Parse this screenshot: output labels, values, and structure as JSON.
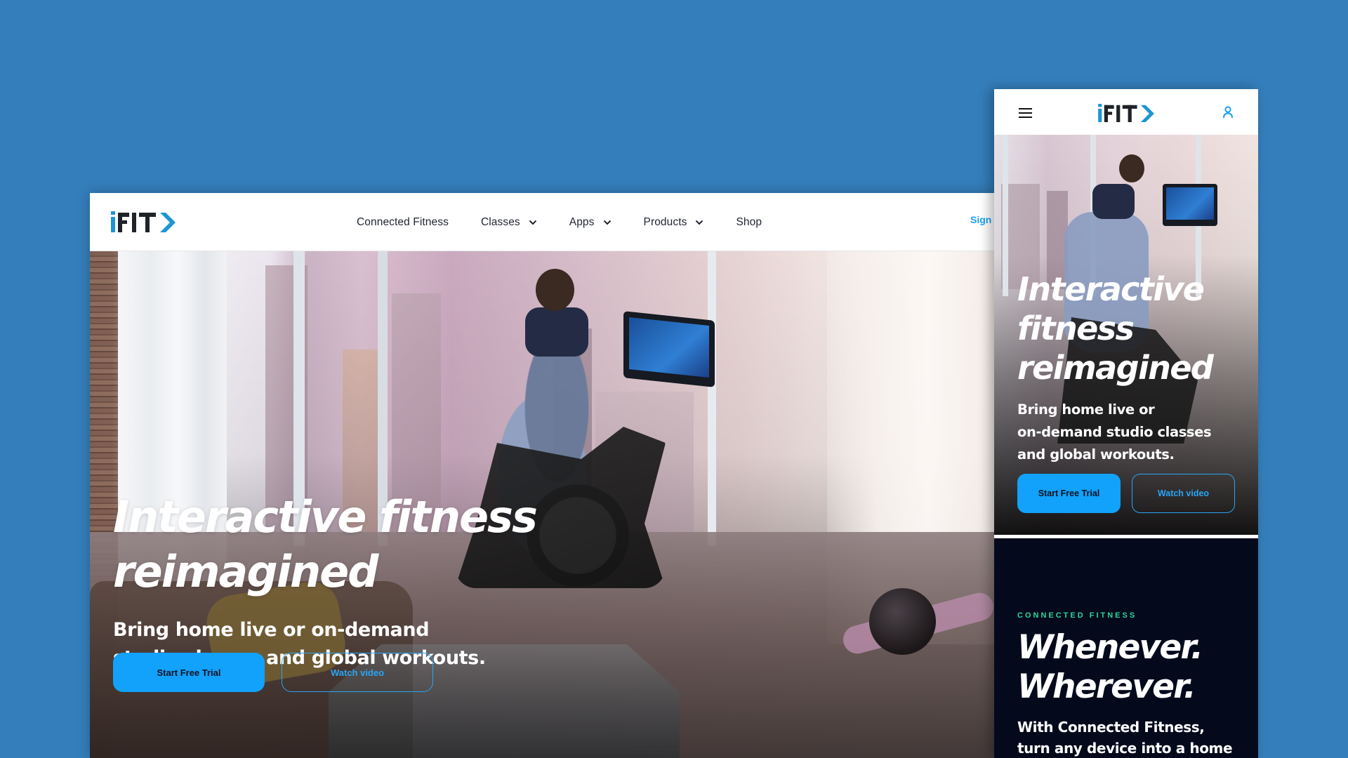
{
  "brand": {
    "name": "iFIT",
    "colors": {
      "background": "#347ebb",
      "accent_blue": "#12a1fb",
      "logo_dark": "#1f2328",
      "logo_blue": "#1d95d3",
      "eyebrow_green": "#2bd69b",
      "dark_section": "#040a1c"
    }
  },
  "desktop": {
    "nav": {
      "logo_alt": "iFIT",
      "items": [
        {
          "label": "Connected Fitness",
          "has_dropdown": false
        },
        {
          "label": "Classes",
          "has_dropdown": true
        },
        {
          "label": "Apps",
          "has_dropdown": true
        },
        {
          "label": "Products",
          "has_dropdown": true
        },
        {
          "label": "Shop",
          "has_dropdown": false
        }
      ],
      "sign_in": "Sign In"
    },
    "hero": {
      "title_line1": "Interactive fitness",
      "title_line2": "reimagined",
      "subtitle_line1": "Bring home live or on-demand",
      "subtitle_line2": "studio classes and global workouts.",
      "primary_button": "Start Free Trial",
      "secondary_button": "Watch video"
    }
  },
  "mobile": {
    "header": {
      "menu_icon": "hamburger-icon",
      "logo_alt": "iFIT",
      "account_icon": "user-icon"
    },
    "hero": {
      "title_lines": [
        "Interactive",
        "fitness",
        "reimagined"
      ],
      "subtitle_lines": [
        "Bring home live or",
        "on-demand studio classes",
        "and global workouts."
      ],
      "primary_button": "Start Free Trial",
      "secondary_button": "Watch video"
    },
    "section": {
      "eyebrow": "CONNECTED FITNESS",
      "title_lines": [
        "Whenever.",
        "Wherever."
      ],
      "body_lines": [
        "With Connected Fitness,",
        "turn any device into a home"
      ]
    }
  }
}
